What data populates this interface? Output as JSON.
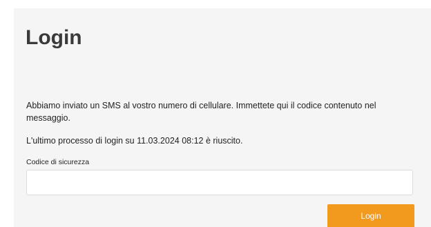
{
  "login": {
    "title": "Login",
    "message": "Abbiamo inviato un SMS al vostro numero di cellulare. Immettete qui il codice contenuto nel messaggio.",
    "last_login": "L'ultimo processo di login su 11.03.2024 08:12 è riuscito.",
    "code_label": "Codice di sicurezza",
    "code_value": "",
    "code_placeholder": "",
    "button_label": "Login"
  },
  "colors": {
    "panel_background": "#f5f5f5",
    "accent": "#f29a1e",
    "input_border": "#dcdcdc"
  }
}
